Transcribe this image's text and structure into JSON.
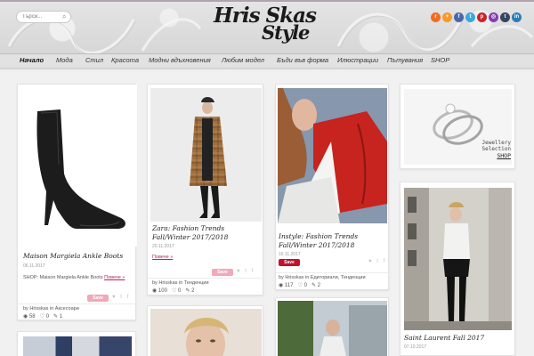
{
  "header": {
    "search_placeholder": "Търси...",
    "logo_line1": "Hris Skas",
    "logo_line2": "Style",
    "social_icons": [
      {
        "name": "rss-icon",
        "glyph": "r",
        "color": "#f26d1f"
      },
      {
        "name": "bloglovin-icon",
        "glyph": "+",
        "color": "#f59a2b"
      },
      {
        "name": "facebook-icon",
        "glyph": "f",
        "color": "#4a67a8"
      },
      {
        "name": "twitter-icon",
        "glyph": "t",
        "color": "#39a9e0"
      },
      {
        "name": "pinterest-icon",
        "glyph": "p",
        "color": "#c8232c"
      },
      {
        "name": "instagram-icon",
        "glyph": "◎",
        "color": "#8a3ab9"
      },
      {
        "name": "tumblr-icon",
        "glyph": "t",
        "color": "#35465c"
      },
      {
        "name": "linkedin-icon",
        "glyph": "in",
        "color": "#2d7bb6"
      }
    ]
  },
  "nav": {
    "items": [
      "Начало",
      "Мода",
      "Стил",
      "Красота",
      "Модни вдъхновения",
      "Любим модел",
      "Бъди във форма",
      "Илюстрации",
      "Пътувания",
      "SHOP"
    ]
  },
  "cards": {
    "boots": {
      "title": "Maison Margiela Ankle Boots",
      "date": "06.11.2017",
      "excerpt": "SHOP: Maison Margiela Ankle Boots",
      "more": "Повече »",
      "save": "Save",
      "author": "Hrisskas",
      "category": "Аксесоари",
      "views": "58",
      "likes": "0",
      "comments": "1"
    },
    "zara": {
      "title": "Zara: Fashion Trends Fall/Winter 2017/2018",
      "date": "20.11.2017",
      "more": "Повече »",
      "save": "Save",
      "author": "Hrisskas",
      "category": "Тенденции",
      "views": "100",
      "likes": "0",
      "comments": "2"
    },
    "instyle": {
      "title": "Instyle: Fashion Trends Fall/Winter 2017/2018",
      "date": "16.11.2017",
      "save": "Save",
      "author": "Hrisskas",
      "category": "Едиториали, Тенденции",
      "views": "117",
      "likes": "0",
      "comments": "2"
    },
    "jewellery": {
      "line1": "Jewellery",
      "line2": "Selection",
      "shop": "SHOP"
    },
    "saint_laurent": {
      "title": "Saint Laurent Fall 2017",
      "date": "07.10.2017"
    }
  },
  "colors": {
    "accent": "#b5245a",
    "save_button": "#c4112c"
  }
}
